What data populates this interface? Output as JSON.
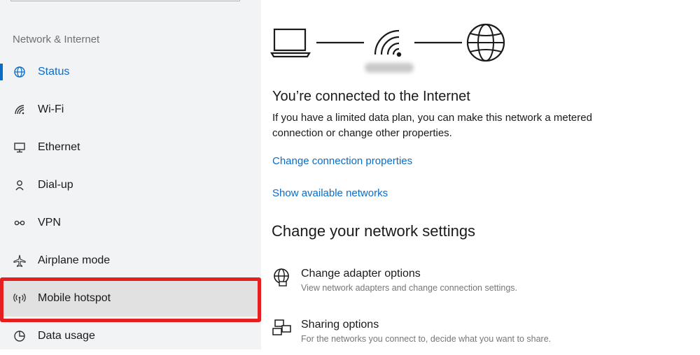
{
  "sidebar": {
    "heading": "Network & Internet",
    "items": [
      {
        "label": "Status",
        "icon": "globe-icon"
      },
      {
        "label": "Wi-Fi",
        "icon": "wifi-icon"
      },
      {
        "label": "Ethernet",
        "icon": "ethernet-icon"
      },
      {
        "label": "Dial-up",
        "icon": "dialup-icon"
      },
      {
        "label": "VPN",
        "icon": "vpn-icon"
      },
      {
        "label": "Airplane mode",
        "icon": "airplane-icon"
      },
      {
        "label": "Mobile hotspot",
        "icon": "hotspot-icon"
      },
      {
        "label": "Data usage",
        "icon": "data-usage-icon"
      }
    ],
    "active_item": "Status",
    "highlighted_item": "Mobile hotspot"
  },
  "main": {
    "status_title": "You’re connected to the Internet",
    "status_desc": "If you have a limited data plan, you can make this network a metered connection or change other properties.",
    "links": {
      "change_connection": "Change connection properties",
      "show_networks": "Show available networks"
    },
    "section_title": "Change your network settings",
    "options": [
      {
        "title": "Change adapter options",
        "desc": "View network adapters and change connection settings.",
        "icon": "adapter-globe-icon"
      },
      {
        "title": "Sharing options",
        "desc": "For the networks you connect to, decide what you want to share.",
        "icon": "sharing-icon"
      }
    ]
  },
  "colors": {
    "accent": "#0a6cc7",
    "highlight_box": "#e51f1f",
    "sidebar_bg": "#f1f3f5"
  }
}
